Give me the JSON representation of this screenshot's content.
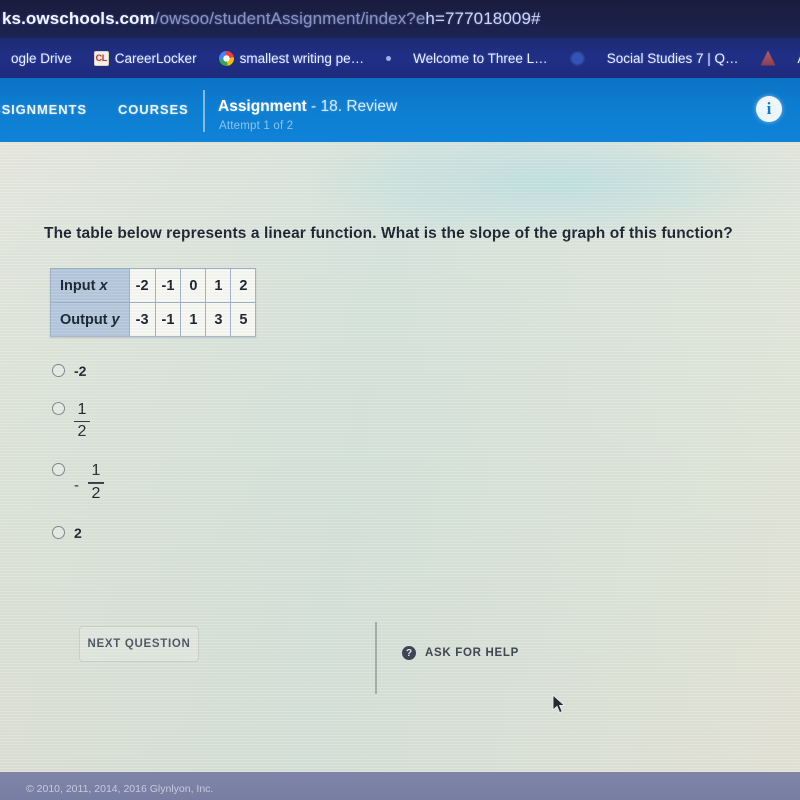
{
  "browser": {
    "url": {
      "domain": "ks.owschools.com",
      "path": "/owsoo/studentAssignment/index?e",
      "tail": "h=777018009#"
    },
    "bookmarks": [
      {
        "label": "ogle Drive",
        "icon": "drive-icon"
      },
      {
        "label": "CareerLocker",
        "icon": "careerlocker-icon",
        "glyph": "CL"
      },
      {
        "label": "smallest writing pe…",
        "icon": "google-icon"
      },
      {
        "label": "",
        "icon": "dot-icon"
      },
      {
        "label": "Welcome to Three L…",
        "icon": "none"
      },
      {
        "label": "",
        "icon": "blue-circle-icon"
      },
      {
        "label": "Social Studies 7 | Q…",
        "icon": "none"
      },
      {
        "label": "",
        "icon": "red-triangle-icon"
      },
      {
        "label": "AL",
        "icon": "none"
      }
    ]
  },
  "appnav": {
    "assignments_label": "SSIGNMENTS",
    "courses_label": "COURSES",
    "assignment_label": "Assignment",
    "assignment_name": "- 18. Review",
    "attempt": "Attempt 1 of 2",
    "info_glyph": "i",
    "accent_color": "#0d7cd0"
  },
  "question": {
    "text": "The table below represents a linear function. What is the slope of the graph of this function?"
  },
  "table": {
    "rows": [
      {
        "header": "Input ",
        "header_italic": "x",
        "cells": [
          "-2",
          "-1",
          "0",
          "1",
          "2"
        ]
      },
      {
        "header": "Output ",
        "header_italic": "y",
        "cells": [
          "-3",
          "-1",
          "1",
          "3",
          "5"
        ]
      }
    ],
    "header_bg": "#b5c8dd"
  },
  "options": [
    {
      "id": "a",
      "kind": "plain",
      "text": "-2",
      "selected": false
    },
    {
      "id": "b",
      "kind": "fraction",
      "numerator": "1",
      "denominator": "2",
      "sign": "",
      "selected": false
    },
    {
      "id": "c",
      "kind": "fraction",
      "numerator": "1",
      "denominator": "2",
      "sign": "-",
      "selected": false
    },
    {
      "id": "d",
      "kind": "plain",
      "text": "2",
      "selected": false
    }
  ],
  "actions": {
    "next_question_label": "NEXT QUESTION",
    "ask_for_help_label": "ASK FOR HELP",
    "ask_icon_glyph": "?"
  },
  "footer": {
    "copyright": "© 2010, 2011, 2014, 2016 Glynlyon, Inc."
  }
}
